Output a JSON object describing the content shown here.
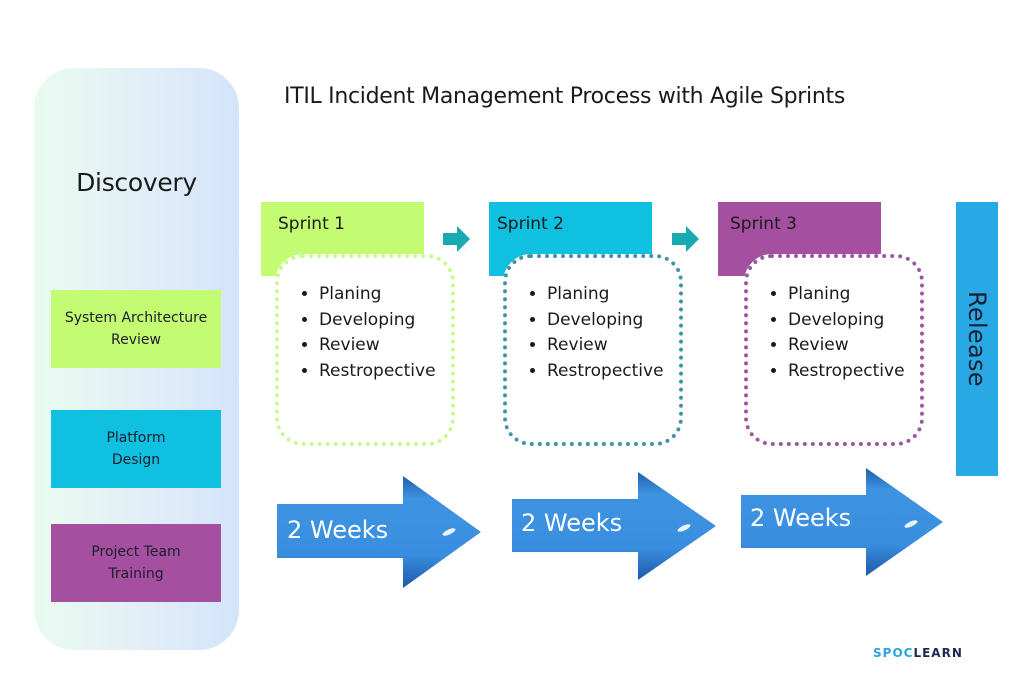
{
  "title": "ITIL Incident Management Process with Agile Sprints",
  "discovery": {
    "title": "Discovery",
    "phases": [
      {
        "line1": "System Architecture",
        "line2": "Review",
        "color": "#c3fb72"
      },
      {
        "line1": "Platform",
        "line2": "Design",
        "color": "#0fc0e0"
      },
      {
        "line1": "Project Team",
        "line2": "Training",
        "color": "#a44fa0"
      }
    ]
  },
  "sprints": [
    {
      "label": "Sprint 1",
      "color": "#c3fb72",
      "items": [
        "Planing",
        "Developing",
        "Review",
        "Restropective"
      ],
      "duration": "2 Weeks"
    },
    {
      "label": "Sprint 2",
      "color": "#0fc0e0",
      "items": [
        "Planing",
        "Developing",
        "Review",
        "Restropective"
      ],
      "duration": "2 Weeks"
    },
    {
      "label": "Sprint 3",
      "color": "#a44fa0",
      "items": [
        "Planing",
        "Developing",
        "Review",
        "Restropective"
      ],
      "duration": "2 Weeks"
    }
  ],
  "release": {
    "label": "Release",
    "color": "#29a8e6"
  },
  "connector_color": "#17aab0",
  "logo": {
    "part1": "SPOC",
    "part2": "LEARN"
  }
}
